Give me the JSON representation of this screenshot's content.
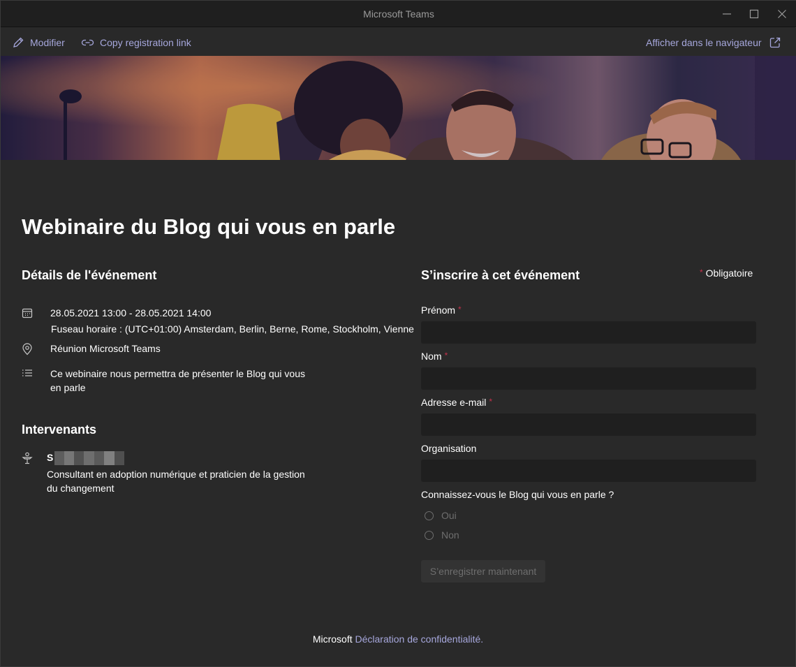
{
  "window": {
    "title": "Microsoft Teams"
  },
  "toolbar": {
    "edit_label": "Modifier",
    "copy_link_label": "Copy registration link",
    "open_browser_label": "Afficher dans le navigateur"
  },
  "event": {
    "title": "Webinaire du Blog qui vous en parle",
    "details_heading": "Détails de l'événement",
    "datetime": "28.05.2021 13:00 - 28.05.2021 14:00",
    "timezone": "Fuseau horaire : (UTC+01:00) Amsterdam, Berlin, Berne, Rome, Stockholm, Vienne",
    "location": "Réunion Microsoft Teams",
    "description_line1": "Ce webinaire nous permettra de présenter le Blog qui vous",
    "description_line2": "en parle"
  },
  "speakers": {
    "heading": "Intervenants",
    "items": [
      {
        "name_initial": "S",
        "role_line1": "Consultant en adoption numérique et praticien de la gestion",
        "role_line2": "du changement"
      }
    ]
  },
  "registration": {
    "heading": "S’inscrire à cet événement",
    "required_star": "*",
    "required_label": "Obligatoire",
    "fields": [
      {
        "label": "Prénom",
        "required": true,
        "value": ""
      },
      {
        "label": "Nom",
        "required": true,
        "value": ""
      },
      {
        "label": "Adresse e-mail",
        "required": true,
        "value": ""
      },
      {
        "label": "Organisation",
        "required": false,
        "value": ""
      }
    ],
    "question": "Connaissez-vous le Blog qui vous en parle ?",
    "options": [
      "Oui",
      "Non"
    ],
    "submit_label": "S’enregistrer maintenant"
  },
  "footer": {
    "brand": "Microsoft",
    "privacy_link": "Déclaration de confidentialité."
  },
  "colors": {
    "accent": "#a6a7dc",
    "background": "#292929",
    "input_background": "#1f1f1f",
    "required": "#c4314b"
  }
}
